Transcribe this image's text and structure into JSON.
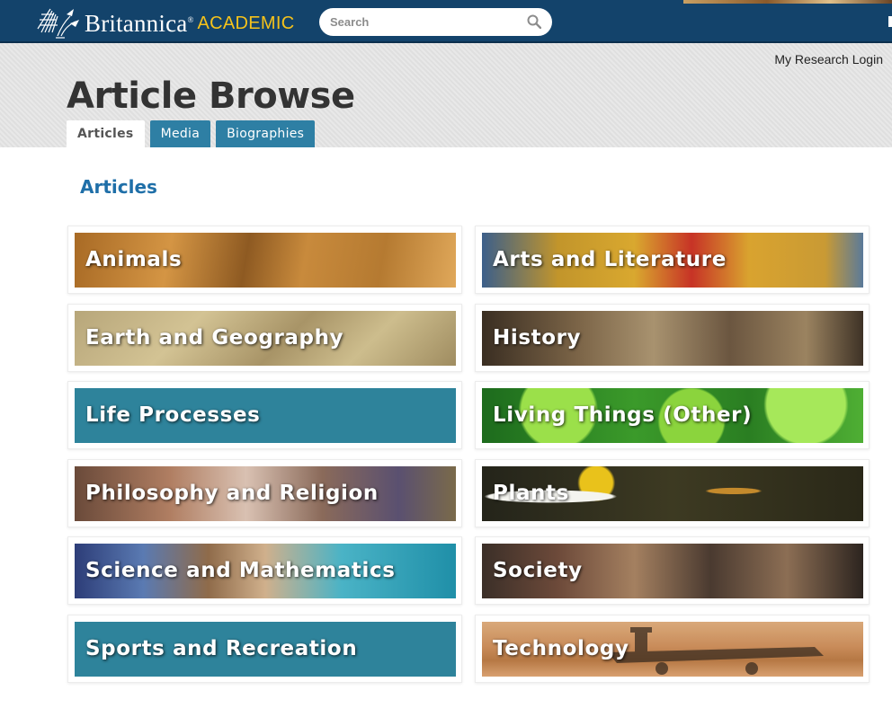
{
  "topbar": {
    "brand_name": "Britannica",
    "brand_mark": "®",
    "brand_suffix": "ACADEMIC",
    "search_placeholder": "Search"
  },
  "header": {
    "login_link": "My Research Login",
    "title": "Article Browse",
    "tabs": [
      {
        "label": "Articles",
        "active": true
      },
      {
        "label": "Media",
        "active": false
      },
      {
        "label": "Biographies",
        "active": false
      }
    ]
  },
  "main": {
    "section_title": "Articles",
    "categories": [
      {
        "label": "Animals",
        "icon": "lion-photo"
      },
      {
        "label": "Arts and Literature",
        "icon": "painting-photo"
      },
      {
        "label": "Earth and Geography",
        "icon": "map-photo"
      },
      {
        "label": "History",
        "icon": "cathedral-photo"
      },
      {
        "label": "Life Processes",
        "icon": "solid-teal"
      },
      {
        "label": "Living Things (Other)",
        "icon": "cells-photo"
      },
      {
        "label": "Philosophy and Religion",
        "icon": "fresco-photo"
      },
      {
        "label": "Plants",
        "icon": "bee-flower-photo"
      },
      {
        "label": "Science and Mathematics",
        "icon": "lab-photo"
      },
      {
        "label": "Society",
        "icon": "assembly-photo"
      },
      {
        "label": "Sports and Recreation",
        "icon": "solid-teal"
      },
      {
        "label": "Technology",
        "icon": "rover-photo"
      }
    ]
  },
  "colors": {
    "topbar": "#13436b",
    "academic_text": "#f5c21b",
    "tab": "#2e7fa4",
    "section_title": "#1f6fa8",
    "solid_banner": "#2e839b"
  }
}
